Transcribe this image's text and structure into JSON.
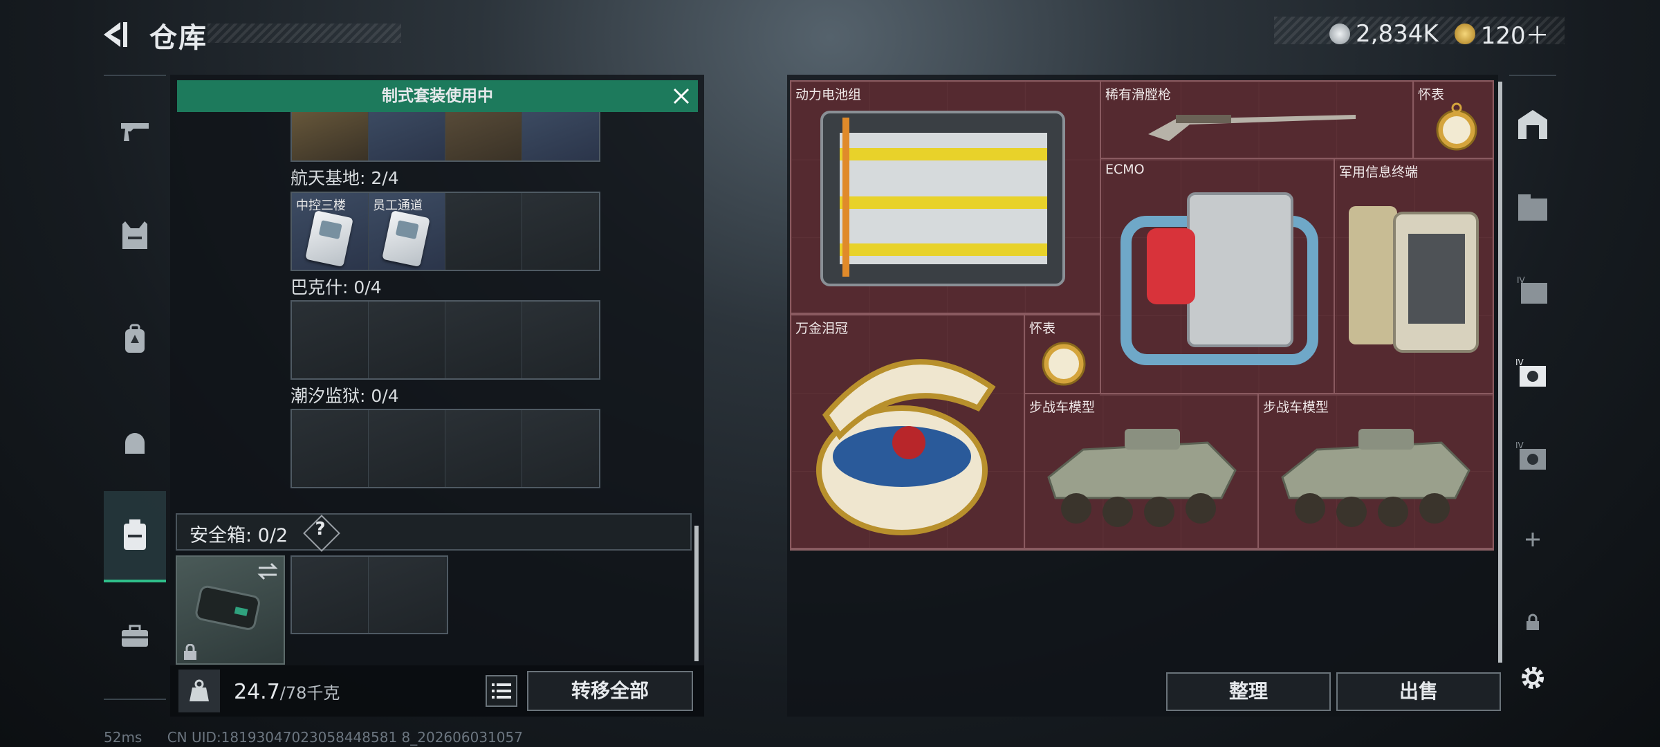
{
  "header": {
    "title": "仓库",
    "currency": [
      {
        "icon": "silver-coin-icon",
        "value": "2,834K",
        "color": "#c9ced3"
      },
      {
        "icon": "gold-coin-icon",
        "value": "120＋",
        "color": "#d8a93a"
      }
    ]
  },
  "left_rail": [
    {
      "icon": "gun-icon"
    },
    {
      "icon": "armor-vest-icon"
    },
    {
      "icon": "backpack-icon"
    },
    {
      "icon": "helmet-icon"
    },
    {
      "icon": "case-icon",
      "active": true
    },
    {
      "icon": "toolbox-icon"
    }
  ],
  "banner": {
    "text": "制式套装使用中"
  },
  "key_groups": [
    {
      "label": "航天基地: 2/4",
      "slots": [
        "中控三楼",
        "员工通道",
        "",
        ""
      ]
    },
    {
      "label": "巴克什: 0/4",
      "slots": [
        "",
        "",
        "",
        ""
      ]
    },
    {
      "label": "潮汐监狱: 0/4",
      "slots": [
        "",
        "",
        "",
        ""
      ]
    }
  ],
  "safe_box": {
    "label": "安全箱: 0/2",
    "help": "?"
  },
  "capacity": {
    "value": "24.7",
    "max": "/78千克"
  },
  "buttons": {
    "transfer_all": "转移全部",
    "sort": "整理",
    "sell": "出售"
  },
  "loot_items": [
    {
      "name": "动力电池组",
      "icon": "battery-pack-icon"
    },
    {
      "name": "稀有滑膛枪",
      "icon": "musket-icon"
    },
    {
      "name": "怀表",
      "icon": "pocket-watch-icon"
    },
    {
      "name": "ECMO",
      "icon": "ecmo-machine-icon"
    },
    {
      "name": "军用信息终端",
      "icon": "military-terminal-icon"
    },
    {
      "name": "万金泪冠",
      "icon": "jeweled-egg-icon"
    },
    {
      "name": "怀表",
      "icon": "pocket-watch-icon"
    },
    {
      "name": "步战车模型",
      "icon": "ifv-model-icon"
    },
    {
      "name": "步战车模型",
      "icon": "ifv-model-icon"
    }
  ],
  "right_rail": [
    {
      "icon": "storage-icon"
    },
    {
      "icon": "crate-icon"
    },
    {
      "icon": "crate-iv-icon"
    },
    {
      "icon": "crate-iv-active-icon"
    },
    {
      "icon": "crate-iv-alt-icon"
    },
    {
      "icon": "plus-icon"
    },
    {
      "icon": "lock-icon"
    },
    {
      "icon": "gear-icon"
    }
  ],
  "status": {
    "ping": "52ms",
    "uid": "CN UID:18193047023058448581 8_202606031057"
  }
}
